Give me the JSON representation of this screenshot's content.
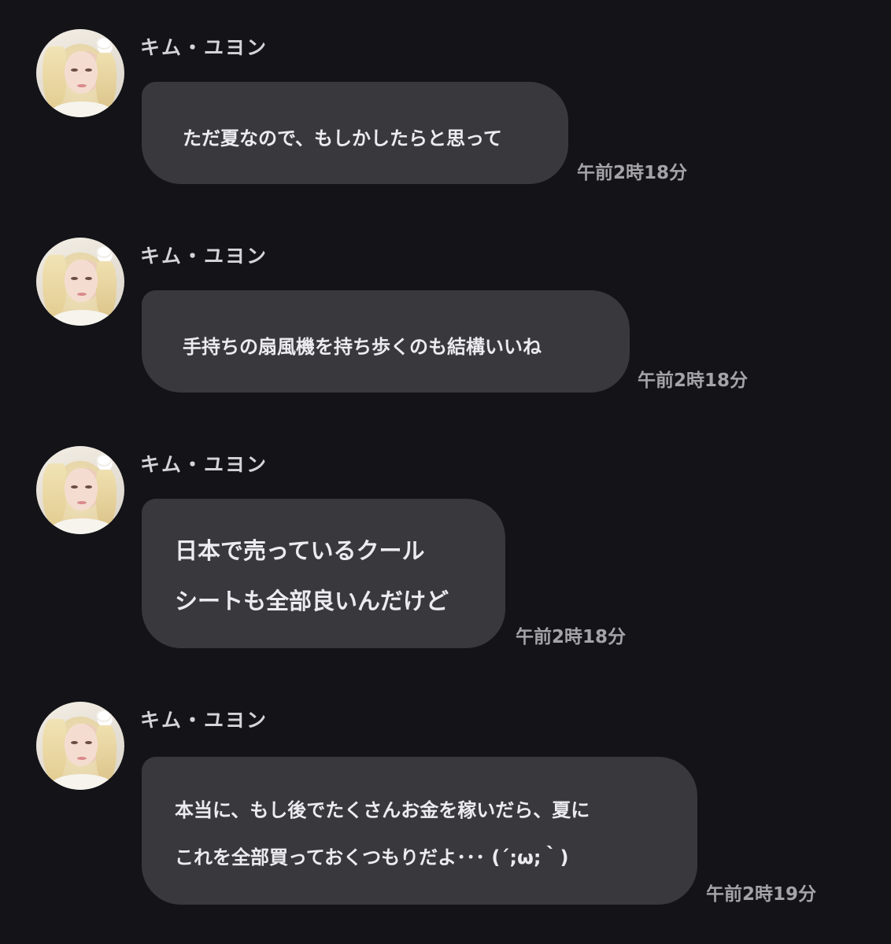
{
  "messages": [
    {
      "sender": "キム・ユヨン",
      "lines": [
        "ただ夏なので、もしかしたらと思って"
      ],
      "time": "午前2時18分"
    },
    {
      "sender": "キム・ユヨン",
      "lines": [
        "手持ちの扇風機を持ち歩くのも結構いいね"
      ],
      "time": "午前2時18分"
    },
    {
      "sender": "キム・ユヨン",
      "lines": [
        "日本で売っているクール",
        "シートも全部良いんだけど"
      ],
      "time": "午前2時18分"
    },
    {
      "sender": "キム・ユヨン",
      "lines": [
        "本当に、もし後でたくさんお金を稼いだら、夏に",
        "これを全部買っておくつもりだよ･･･ (´;ω;｀)"
      ],
      "time": "午前2時19分"
    }
  ]
}
